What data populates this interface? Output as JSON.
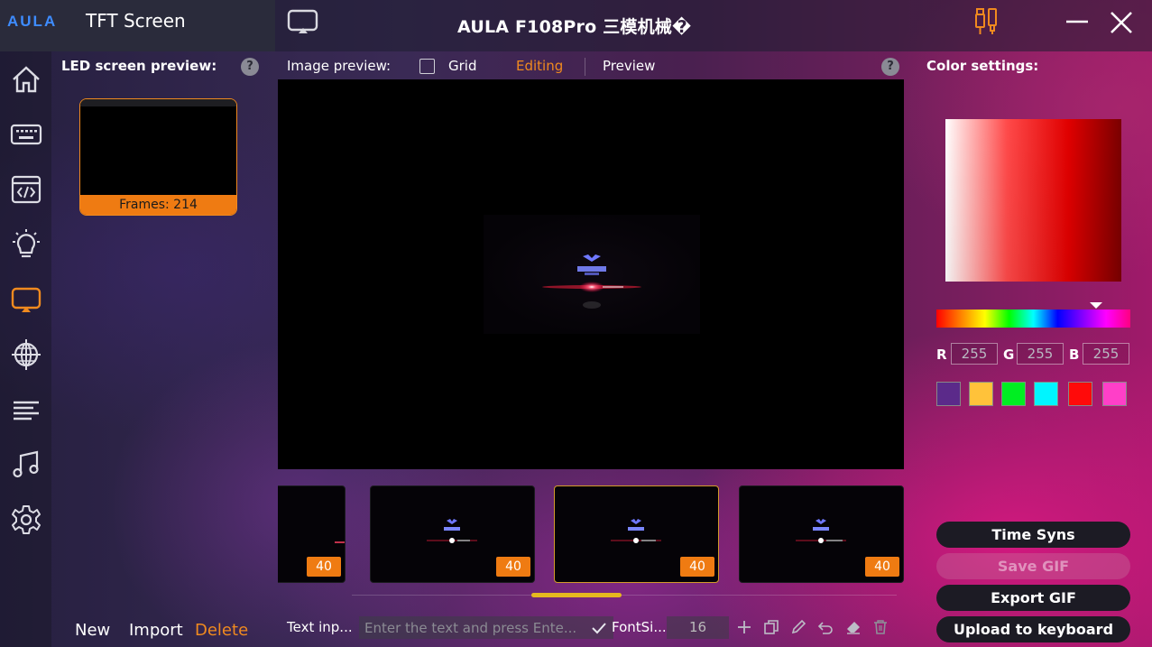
{
  "window": {
    "brand_logo": "AULA",
    "panel_title": "TFT Screen",
    "app_title": "AULA F108Pro 三模机械�",
    "minimize_label": "minimize",
    "close_label": "close"
  },
  "sidebar": {
    "items": [
      {
        "name": "home",
        "icon": "home-icon"
      },
      {
        "name": "keyboard",
        "icon": "keyboard-icon"
      },
      {
        "name": "macro",
        "icon": "code-window-icon"
      },
      {
        "name": "lighting",
        "icon": "bulb-icon"
      },
      {
        "name": "tft-screen",
        "icon": "screen-cast-icon",
        "active": true
      },
      {
        "name": "network",
        "icon": "globe-icon"
      },
      {
        "name": "list",
        "icon": "lines-icon"
      },
      {
        "name": "music",
        "icon": "music-icon"
      },
      {
        "name": "settings",
        "icon": "gear-icon"
      }
    ]
  },
  "left_panel": {
    "title": "LED screen preview:",
    "help": "?",
    "frames_label": "Frames: 214",
    "new_label": "New",
    "import_label": "Import",
    "delete_label": "Delete"
  },
  "toolbar": {
    "image_preview_label": "Image preview:",
    "grid_label": "Grid",
    "grid_checked": false,
    "editing_tab": "Editing",
    "preview_tab": "Preview",
    "help": "?"
  },
  "thumbnails": [
    {
      "badge": "40"
    },
    {
      "badge": "40"
    },
    {
      "badge": "40",
      "selected": true
    },
    {
      "badge": "40"
    }
  ],
  "text_tools": {
    "text_input_label": "Text inp...",
    "text_placeholder": "Enter the text and press Ente...",
    "text_value": "",
    "font_size_label": "FontSi...",
    "font_size_value": "16"
  },
  "color_panel": {
    "title": "Color settings:",
    "r_label": "R",
    "r_value": "255",
    "g_label": "G",
    "g_value": "255",
    "b_label": "B",
    "b_value": "255",
    "hue_position": 0.83,
    "swatches": [
      "#5b2a8a",
      "#ffc23a",
      "#00ee22",
      "#00f5ff",
      "#ff0a0a",
      "#ff3fc8"
    ]
  },
  "actions": {
    "time_sync": "Time Syns",
    "save_gif": "Save GIF",
    "export_gif": "Export GIF",
    "upload": "Upload to keyboard"
  },
  "colors": {
    "accent": "#f08a1f",
    "badge": "#ef7b12",
    "scroll_indicator": "#e6b81f",
    "logo_blue": "#3e8cff"
  }
}
